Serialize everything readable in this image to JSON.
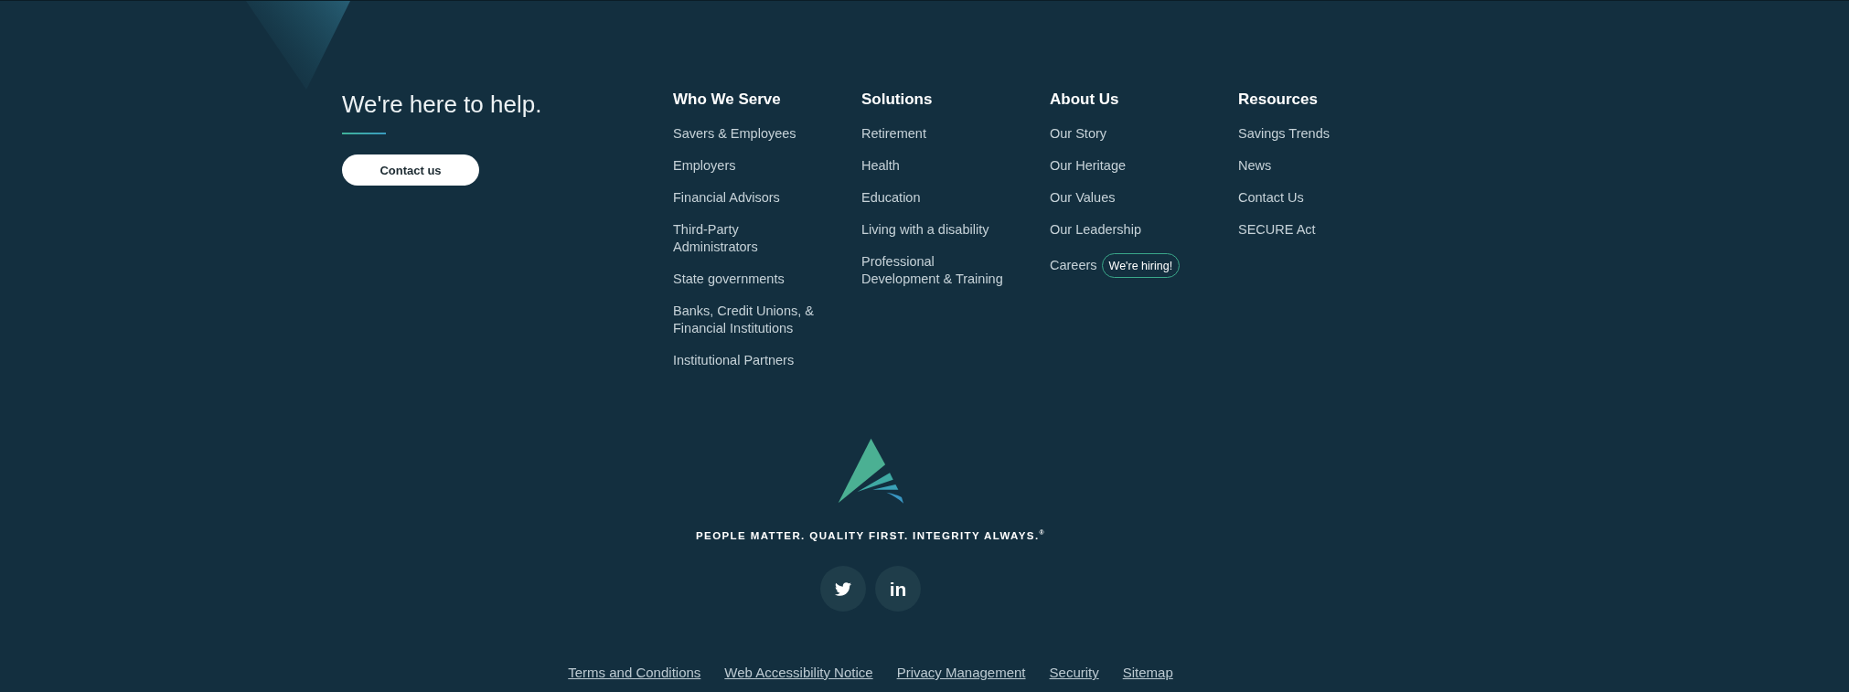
{
  "help": {
    "heading": "We're here to help.",
    "button": "Contact us"
  },
  "columns": [
    {
      "heading": "Who We Serve",
      "links": [
        {
          "label": "Savers & Employees"
        },
        {
          "label": "Employers"
        },
        {
          "label": "Financial Advisors"
        },
        {
          "label": "Third-Party Administrators"
        },
        {
          "label": "State governments"
        },
        {
          "label": "Banks, Credit Unions, & Financial Institutions"
        },
        {
          "label": "Institutional Partners"
        }
      ]
    },
    {
      "heading": "Solutions",
      "links": [
        {
          "label": "Retirement"
        },
        {
          "label": "Health"
        },
        {
          "label": "Education"
        },
        {
          "label": "Living with a disability"
        },
        {
          "label": "Professional Development & Training"
        }
      ]
    },
    {
      "heading": "About Us",
      "links": [
        {
          "label": "Our Story"
        },
        {
          "label": "Our Heritage"
        },
        {
          "label": "Our Values"
        },
        {
          "label": "Our Leadership"
        },
        {
          "label": "Careers",
          "badge": "We're hiring!"
        }
      ]
    },
    {
      "heading": "Resources",
      "links": [
        {
          "label": "Savings Trends"
        },
        {
          "label": "News"
        },
        {
          "label": "Contact Us"
        },
        {
          "label": "SECURE Act"
        }
      ]
    }
  ],
  "tagline": "PEOPLE MATTER. QUALITY FIRST. INTEGRITY ALWAYS.$^{®}$",
  "social_buttons": [
    {
      "kind": "bird"
    },
    {
      "kind": "text",
      "label": "in"
    }
  ],
  "legal_links": [
    "Terms and Conditions",
    "Web Accessibility Notice",
    "Privacy Management",
    "Security",
    "Sitemap"
  ]
}
